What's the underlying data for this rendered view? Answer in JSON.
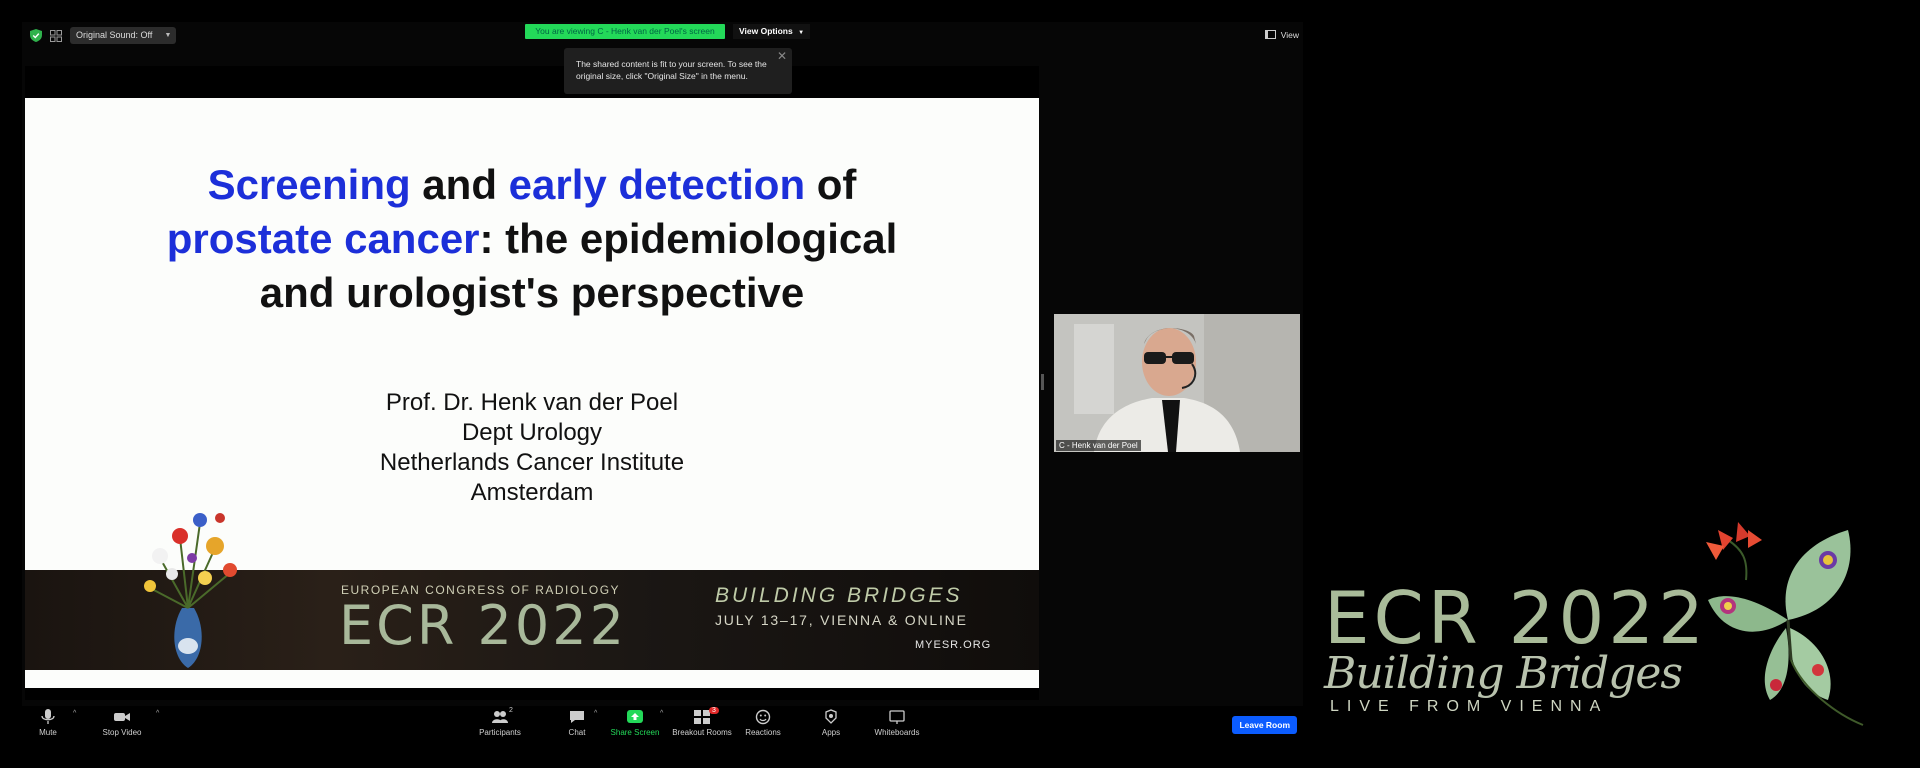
{
  "top_bar": {
    "sound_label": "Original Sound: Off",
    "viewing_banner": "You are viewing C - Henk van der Poel's screen",
    "view_options_label": "View Options",
    "view_label": "View"
  },
  "tooltip": {
    "text": "The shared content is fit to your screen. To see the original size, click \"Original Size\" in the menu."
  },
  "slide": {
    "title_part1": "Screening",
    "title_part2": " and ",
    "title_part3": "early detection",
    "title_part4": " of",
    "title_part5": "prostate cancer",
    "title_part6": ": the epidemiological",
    "title_part7": "and urologist's perspective",
    "author": "Prof. Dr. Henk van der Poel",
    "dept": "Dept Urology",
    "institute": "Netherlands Cancer Institute",
    "city": "Amsterdam",
    "banner": {
      "congress": "EUROPEAN CONGRESS OF RADIOLOGY",
      "ecr": "ECR 2022",
      "building": "BUILDING BRIDGES",
      "dates": "JULY 13–17, VIENNA & ONLINE",
      "url": "MYESR.ORG"
    }
  },
  "participant": {
    "name": "C - Henk van der Poel"
  },
  "toolbar": {
    "mute": "Mute",
    "stop_video": "Stop Video",
    "participants": "Participants",
    "participants_count": "2",
    "chat": "Chat",
    "share_screen": "Share Screen",
    "breakout_rooms": "Breakout Rooms",
    "breakout_badge": "3",
    "reactions": "Reactions",
    "apps": "Apps",
    "whiteboards": "Whiteboards",
    "leave": "Leave Room"
  },
  "logo": {
    "ecr": "ECR 2022",
    "building": "Building Bridges",
    "live": "LIVE FROM VIENNA"
  },
  "colors": {
    "accent_green": "#23d959",
    "leave_blue": "#0b5cff",
    "title_blue": "#1c2fd9",
    "logo_green": "#a9bb99"
  }
}
